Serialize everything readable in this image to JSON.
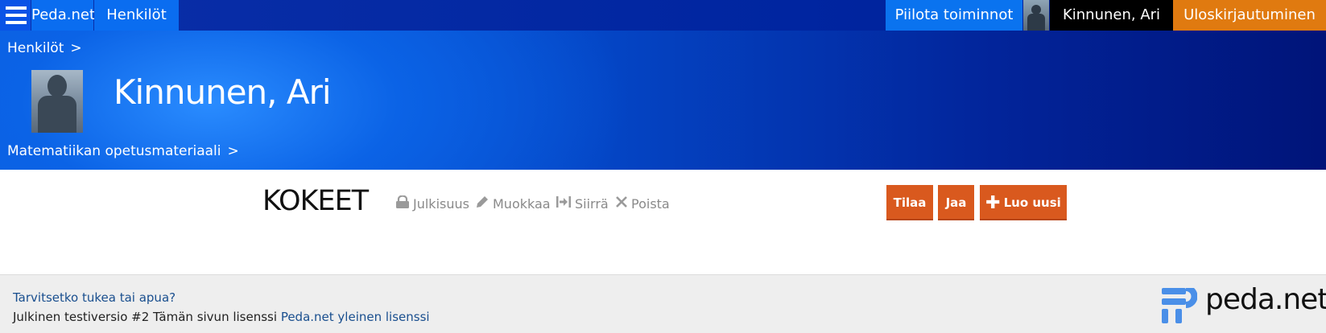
{
  "topbar": {
    "menu_icon": "hamburger-menu-icon",
    "home_label": "Peda.net",
    "people_label": "Henkilöt",
    "hide_actions_label": "Piilota toiminnot",
    "user_name": "Kinnunen, Ari",
    "logout_label": "Uloskirjautuminen"
  },
  "banner": {
    "breadcrumb_top": "Henkilöt",
    "separator": ">",
    "title": "Kinnunen, Ari",
    "breadcrumb_bottom": "Matematiikan opetusmateriaali"
  },
  "content": {
    "section_title": "KOKEET",
    "actions": {
      "publicity": "Julkisuus",
      "edit": "Muokkaa",
      "move": "Siirrä",
      "delete": "Poista"
    },
    "buttons": {
      "subscribe": "Tilaa",
      "share": "Jaa",
      "create_new": "Luo uusi"
    }
  },
  "footer": {
    "help_link": "Tarvitsetko tukea tai apua?",
    "version_text": "Julkinen testiversio #2 Tämän sivun lisenssi",
    "license_link": "Peda.net yleinen lisenssi",
    "logo_text": "peda.net"
  },
  "colors": {
    "accent_blue": "#0a6df0",
    "logout_orange": "#e07a10",
    "button_orange": "#d9591e",
    "link_blue": "#1a4f8f"
  }
}
